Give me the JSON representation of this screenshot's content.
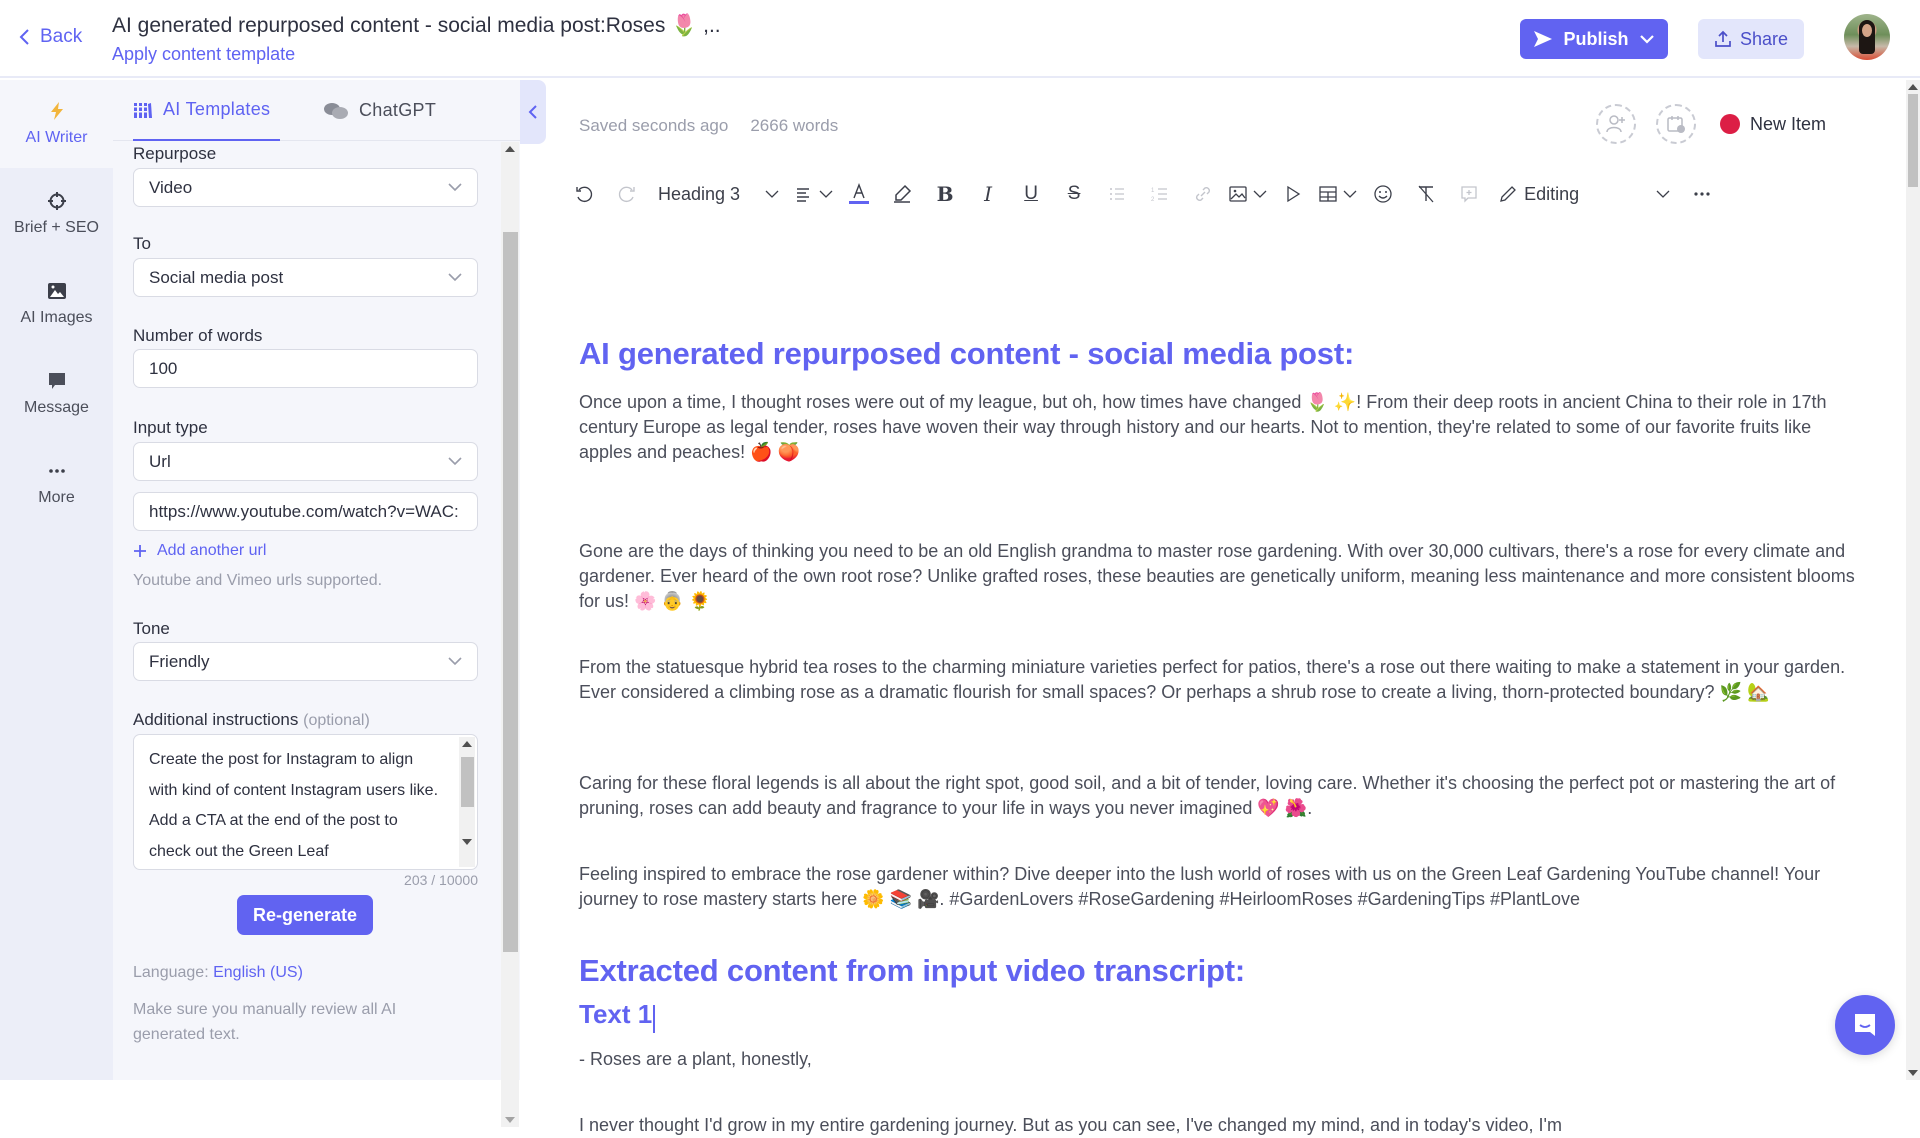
{
  "header": {
    "back_label": "Back",
    "title": "AI generated repurposed content - social media post:Roses 🌷 ,..",
    "apply_template_label": "Apply content template",
    "publish_label": "Publish",
    "share_label": "Share"
  },
  "rail": {
    "items": [
      {
        "label": "AI Writer",
        "icon": "lightning-icon",
        "active": true
      },
      {
        "label": "Brief + SEO",
        "icon": "target-icon"
      },
      {
        "label": "AI Images",
        "icon": "image-icon"
      },
      {
        "label": "Message",
        "icon": "message-icon"
      },
      {
        "label": "More",
        "icon": "more-icon"
      }
    ]
  },
  "panel": {
    "tabs": [
      {
        "label": "AI Templates",
        "icon": "library-icon",
        "active": true
      },
      {
        "label": "ChatGPT",
        "icon": "chat-bubbles-icon"
      }
    ],
    "form": {
      "repurpose_label": "Repurpose",
      "repurpose_value": "Video",
      "to_label": "To",
      "to_value": "Social media post",
      "words_label": "Number of words",
      "words_value": "100",
      "input_type_label": "Input type",
      "input_type_value": "Url",
      "url_value": "https://www.youtube.com/watch?v=WAC:",
      "add_url_label": "Add another url",
      "url_hint": "Youtube and Vimeo urls supported.",
      "tone_label": "Tone",
      "tone_value": "Friendly",
      "instructions_label": "Additional instructions",
      "instructions_optional": "(optional)",
      "instructions_value": "Create the post for Instagram to align with kind of content Instagram users like. Add a CTA at the end of the post to check out the Green Leaf",
      "char_count": "203 / 10000",
      "regenerate_label": "Re-generate",
      "language_prefix": "Language:",
      "language_value": "English (US)",
      "review_note": "Make sure you manually review all AI generated text."
    }
  },
  "editor": {
    "saved_status": "Saved seconds ago",
    "word_count": "2666 words",
    "item_status": "New Item",
    "status_color": "#dc1e45",
    "toolbar": {
      "block_style": "Heading 3",
      "mode": "Editing"
    },
    "heading_1": "AI generated repurposed content - social media post:",
    "paragraphs": [
      "Once upon a time, I thought roses were out of my league, but oh, how times have changed 🌷 ✨! From their deep roots in ancient China to their role in 17th century Europe as legal tender, roses have woven their way through history and our hearts. Not to mention, they're related to some of our favorite fruits like apples and peaches! 🍎 🍑",
      "Gone are the days of thinking you need to be an old English grandma to master rose gardening. With over 30,000 cultivars, there's a rose for every climate and gardener. Ever heard of the own root rose? Unlike grafted roses, these beauties are genetically uniform, meaning less maintenance and more consistent blooms for us! 🌸 👵 🌻",
      "From the statuesque hybrid tea roses to the charming miniature varieties perfect for patios, there's a rose out there waiting to make a statement in your garden. Ever considered a climbing rose as a dramatic flourish for small spaces? Or perhaps a shrub rose to create a living, thorn-protected boundary? 🌿 🏡",
      "Caring for these floral legends is all about the right spot, good soil, and a bit of tender, loving care. Whether it's choosing the perfect pot or mastering the art of pruning, roses can add beauty and fragrance to your life in ways you never imagined 💖 🌺.",
      "Feeling inspired to embrace the rose gardener within? Dive deeper into the lush world of roses with us on the Green Leaf Gardening YouTube channel! Your journey to rose mastery starts here 🌼 📚 🎥. #GardenLovers #RoseGardening #HeirloomRoses #GardeningTips #PlantLove"
    ],
    "heading_2": "Extracted content from input  video transcript:",
    "heading_3": "Text 1",
    "transcript": [
      "- Roses are a plant, honestly,",
      "I never thought I'd grow in my entire gardening journey. But as you can see, I've changed my mind, and in today's video, I'm"
    ]
  },
  "colors": {
    "accent": "#6163f1",
    "accent_light": "#e3e6fb",
    "rail_bg": "#eceef8",
    "panel_bg": "#f5f6fb"
  }
}
